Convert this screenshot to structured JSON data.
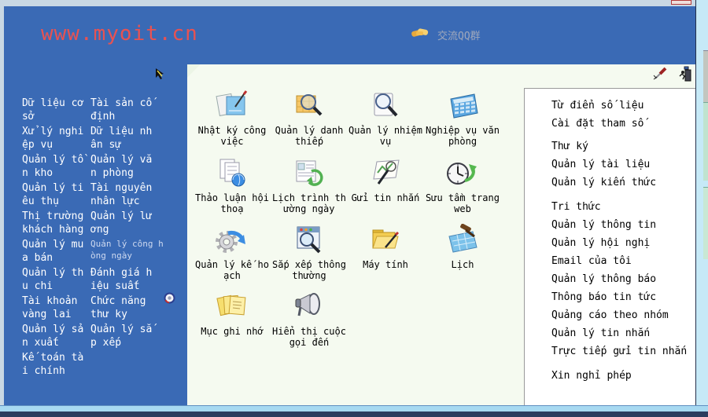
{
  "window": {
    "site_url": "www.myoit.cn",
    "qq_group_label": "交流QQ群"
  },
  "sidebar": {
    "column1": [
      "Dữ liệu cơ\nsở",
      "Xử lý nghi\nệp vụ",
      "Quản lý tồ\nn kho",
      "Quản lý ti\nêu thụ",
      "Thị trường\nkhách hàng",
      "Quản lý mu\na bán",
      "Quản lý th\nu chi",
      "Tài khoản\nvàng lai",
      "Quản lý sả\nn xuất",
      "Kế toán tà\ni chính"
    ],
    "column2": [
      "Tài sản cố\nđịnh",
      "Dữ liệu nh\nân sự",
      "Quản lý vă\nn phòng",
      "Tài nguyên\nnhân lực",
      "Quản lý lư\nơng",
      "Quản lý công h\nòng ngày",
      "Đánh giá h\niệu suất",
      "Chức năng\nthư ky",
      "Quản lý sắ\np xếp"
    ]
  },
  "desktop": {
    "items": [
      {
        "label": "Nhật ký công\nviệc",
        "icon": "journal-icon"
      },
      {
        "label": "Quản lý danh\nthiếp",
        "icon": "card-search-icon"
      },
      {
        "label": "Quản lý nhiệm\nvụ",
        "icon": "task-search-icon"
      },
      {
        "label": "Nghiệp vụ văn\nphòng",
        "icon": "calculator-icon"
      },
      {
        "label": "Thảo luận hội\nthoạ",
        "icon": "discussion-icon"
      },
      {
        "label": "Lịch trình th\nường ngày",
        "icon": "daily-schedule-icon"
      },
      {
        "label": "Gửi tin nhắn",
        "icon": "send-message-icon"
      },
      {
        "label": "Sưu tầm trang\nweb",
        "icon": "web-collect-icon"
      },
      {
        "label": "Quản lý kế ho\nạch",
        "icon": "plan-icon"
      },
      {
        "label": "Sắp xếp thông\nthường",
        "icon": "sort-window-icon"
      },
      {
        "label": "Máy tính",
        "icon": "folder-pen-icon"
      },
      {
        "label": "Lịch",
        "icon": "calendar-gavel-icon"
      },
      {
        "label": "Mục ghi nhớ",
        "icon": "memo-icon"
      },
      {
        "label": "Hiển thị cuộc\ngọi đến",
        "icon": "megaphone-icon"
      }
    ]
  },
  "right_panel": {
    "groups": [
      [
        "Từ điển số liệu",
        "Cài đặt tham số"
      ],
      [
        "Thư ký",
        "Quản lý tài liệu",
        "Quản lý kiến thức"
      ],
      [
        "Tri thức",
        "Quản lý thông tin",
        "Quản lý hội nghị",
        "Email của tôi",
        "Quản lý thông báo",
        "Thông báo tin tức",
        "Quảng cáo theo nhóm",
        "Quản lý tin nhắn",
        "Trực tiếp gửi tin nhắn"
      ],
      [
        "Xin nghỉ phép"
      ]
    ]
  },
  "icons": {
    "header": "handshake-icon",
    "toolbar": [
      "screwdriver-icon",
      "exit-door-icon"
    ],
    "sidebar_badge": "round-record-icon",
    "pointer": "arrow-cursor-icon"
  },
  "colors": {
    "window_blue": "#3a6ab5",
    "site_red": "#e85252",
    "qq_gray": "#9fa8bc",
    "panel_bg": "#f5faf0",
    "right_panel_bg": "#ffffff",
    "border_gray": "#9a9a9a",
    "edge_cyan": "#a7d9f1"
  }
}
